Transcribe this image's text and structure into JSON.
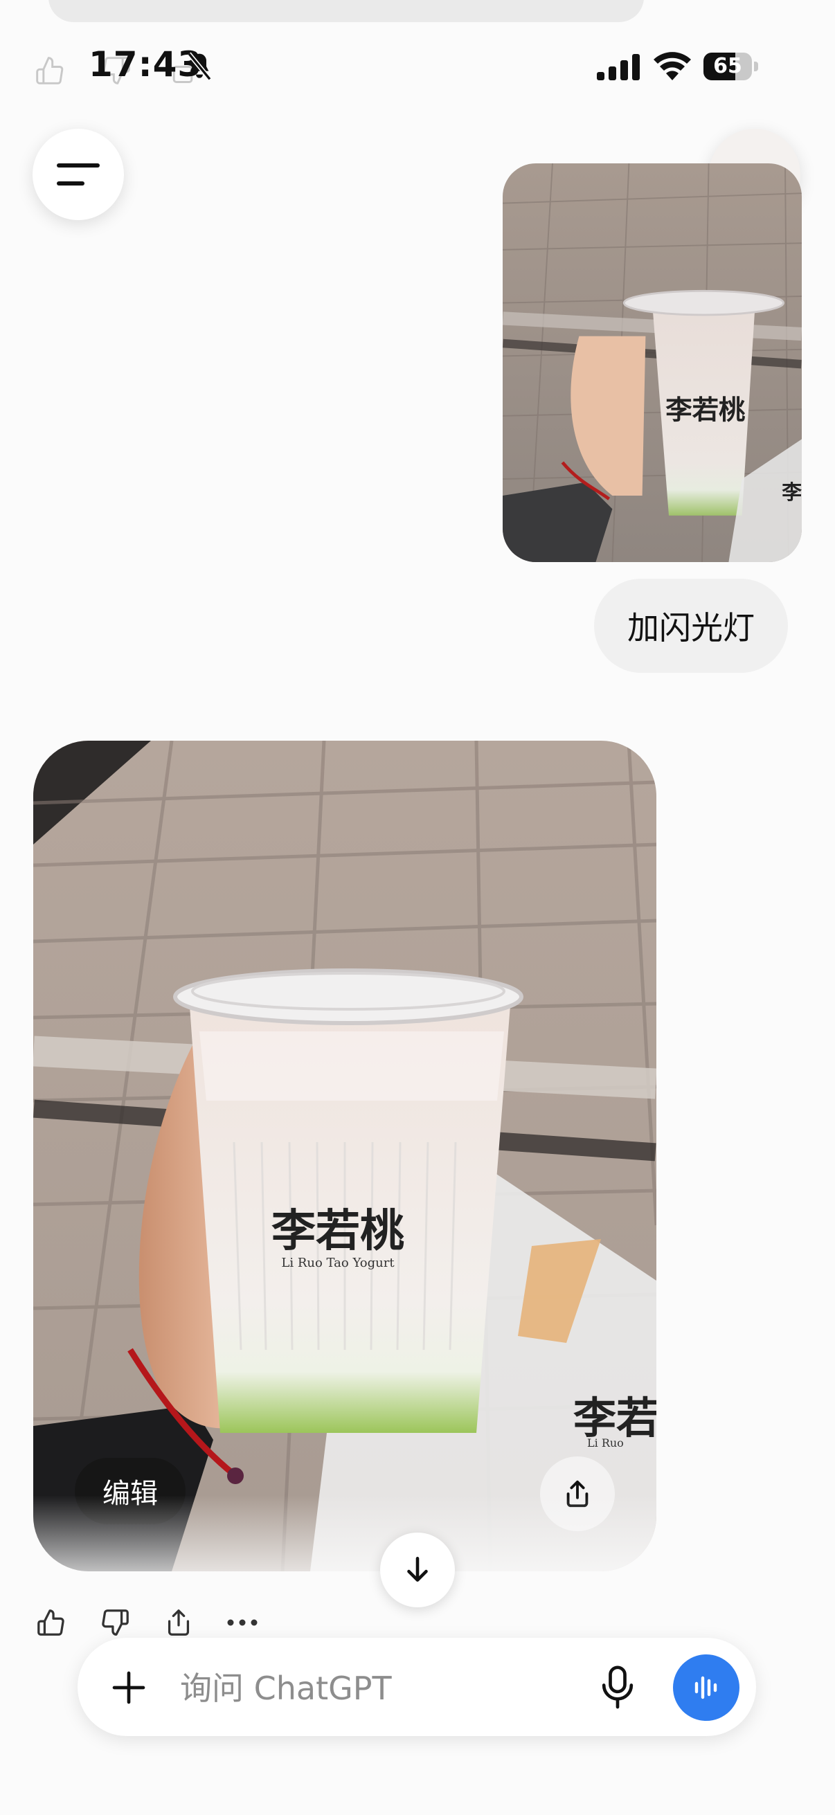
{
  "status_bar": {
    "time": "17:43",
    "battery_level": "65",
    "icons": [
      "bell-slash-icon",
      "cellular-signal-icon",
      "wifi-icon",
      "battery-icon"
    ]
  },
  "header": {
    "menu_icon": "menu-icon",
    "more_icon": "more-horizontal-icon"
  },
  "conversation": {
    "user_message": {
      "image": "photo of a hand holding a cup of yogurt drink with '李若桃' logo",
      "text": "加闪光灯"
    },
    "assistant_message": {
      "image": "flash-lit photo of the same yogurt cup on a tiled sidewalk",
      "cup_logo_text": "李若桃",
      "cup_logo_subtext": "Li Ruo Tao Yogurt",
      "edit_label": "编辑",
      "actions": [
        "thumbs-up-icon",
        "thumbs-down-icon",
        "share-icon",
        "more-horizontal-icon"
      ]
    }
  },
  "composer": {
    "placeholder": "询问 ChatGPT",
    "value": "",
    "icons": [
      "plus-icon",
      "microphone-icon",
      "voice-mode-icon"
    ]
  },
  "colors": {
    "accent": "#2f7df0",
    "bubble": "#f0f0f0",
    "background": "#fbfbfb"
  }
}
